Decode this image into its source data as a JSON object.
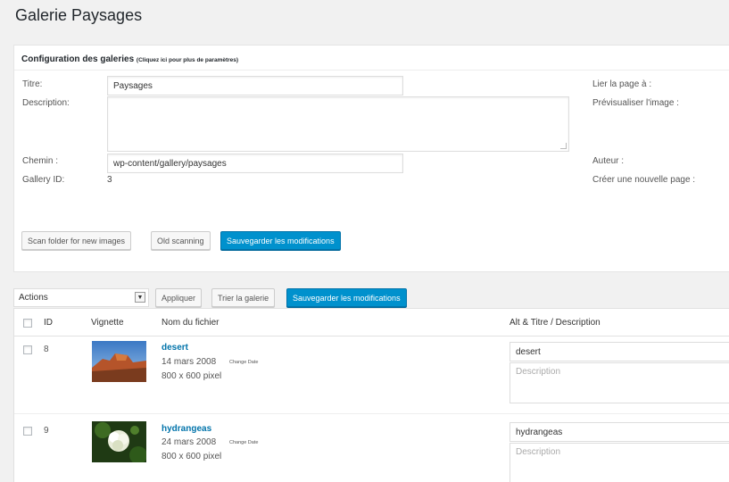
{
  "page": {
    "title": "Galerie Paysages"
  },
  "config": {
    "heading": "Configuration des galeries",
    "heading_hint": "(Cliquez ici pour plus de paramètres)",
    "titre_label": "Titre:",
    "titre_value": "Paysages",
    "description_label": "Description:",
    "description_value": "",
    "chemin_label": "Chemin :",
    "chemin_value": "wp-content/gallery/paysages",
    "gallery_id_label": "Gallery ID:",
    "gallery_id_value": "3",
    "lier_label": "Lier la page à :",
    "previsualiser_label": "Prévisualiser l'image :",
    "auteur_label": "Auteur :",
    "creer_label": "Créer une nouvelle page :",
    "buttons": {
      "scan": "Scan folder for new images",
      "old_scan": "Old scanning",
      "save": "Sauvegarder les modifications"
    }
  },
  "bulk": {
    "actions_selected": "Actions",
    "apply": "Appliquer",
    "sort": "Trier la galerie",
    "save": "Sauvegarder les modifications"
  },
  "table": {
    "headers": {
      "id": "ID",
      "thumb": "Vignette",
      "filename": "Nom du fichier",
      "alt": "Alt & Titre / Description"
    },
    "rows": [
      {
        "id": "8",
        "filename": "desert",
        "date": "14 mars 2008",
        "change_date": "Change Date",
        "size": "800 x 600 pixel",
        "alt": "desert",
        "desc_placeholder": "Description"
      },
      {
        "id": "9",
        "filename": "hydrangeas",
        "date": "24 mars 2008",
        "change_date": "Change Date",
        "size": "800 x 600 pixel",
        "alt": "hydrangeas",
        "desc_placeholder": "Description"
      }
    ]
  },
  "colors": {
    "primary": "#0091cd",
    "link": "#0073aa",
    "background": "#f1f1f1"
  }
}
